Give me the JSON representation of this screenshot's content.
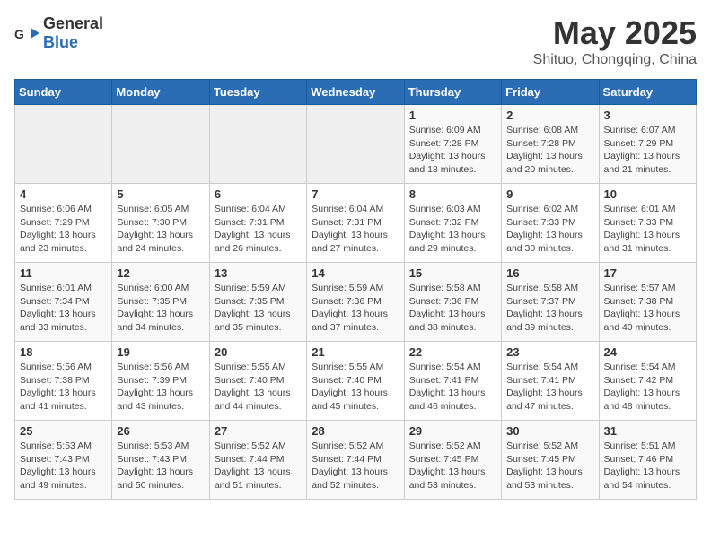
{
  "header": {
    "logo_general": "General",
    "logo_blue": "Blue",
    "title": "May 2025",
    "subtitle": "Shituo, Chongqing, China"
  },
  "weekdays": [
    "Sunday",
    "Monday",
    "Tuesday",
    "Wednesday",
    "Thursday",
    "Friday",
    "Saturday"
  ],
  "weeks": [
    [
      {
        "day": "",
        "info": ""
      },
      {
        "day": "",
        "info": ""
      },
      {
        "day": "",
        "info": ""
      },
      {
        "day": "",
        "info": ""
      },
      {
        "day": "1",
        "info": "Sunrise: 6:09 AM\nSunset: 7:28 PM\nDaylight: 13 hours\nand 18 minutes."
      },
      {
        "day": "2",
        "info": "Sunrise: 6:08 AM\nSunset: 7:28 PM\nDaylight: 13 hours\nand 20 minutes."
      },
      {
        "day": "3",
        "info": "Sunrise: 6:07 AM\nSunset: 7:29 PM\nDaylight: 13 hours\nand 21 minutes."
      }
    ],
    [
      {
        "day": "4",
        "info": "Sunrise: 6:06 AM\nSunset: 7:29 PM\nDaylight: 13 hours\nand 23 minutes."
      },
      {
        "day": "5",
        "info": "Sunrise: 6:05 AM\nSunset: 7:30 PM\nDaylight: 13 hours\nand 24 minutes."
      },
      {
        "day": "6",
        "info": "Sunrise: 6:04 AM\nSunset: 7:31 PM\nDaylight: 13 hours\nand 26 minutes."
      },
      {
        "day": "7",
        "info": "Sunrise: 6:04 AM\nSunset: 7:31 PM\nDaylight: 13 hours\nand 27 minutes."
      },
      {
        "day": "8",
        "info": "Sunrise: 6:03 AM\nSunset: 7:32 PM\nDaylight: 13 hours\nand 29 minutes."
      },
      {
        "day": "9",
        "info": "Sunrise: 6:02 AM\nSunset: 7:33 PM\nDaylight: 13 hours\nand 30 minutes."
      },
      {
        "day": "10",
        "info": "Sunrise: 6:01 AM\nSunset: 7:33 PM\nDaylight: 13 hours\nand 31 minutes."
      }
    ],
    [
      {
        "day": "11",
        "info": "Sunrise: 6:01 AM\nSunset: 7:34 PM\nDaylight: 13 hours\nand 33 minutes."
      },
      {
        "day": "12",
        "info": "Sunrise: 6:00 AM\nSunset: 7:35 PM\nDaylight: 13 hours\nand 34 minutes."
      },
      {
        "day": "13",
        "info": "Sunrise: 5:59 AM\nSunset: 7:35 PM\nDaylight: 13 hours\nand 35 minutes."
      },
      {
        "day": "14",
        "info": "Sunrise: 5:59 AM\nSunset: 7:36 PM\nDaylight: 13 hours\nand 37 minutes."
      },
      {
        "day": "15",
        "info": "Sunrise: 5:58 AM\nSunset: 7:36 PM\nDaylight: 13 hours\nand 38 minutes."
      },
      {
        "day": "16",
        "info": "Sunrise: 5:58 AM\nSunset: 7:37 PM\nDaylight: 13 hours\nand 39 minutes."
      },
      {
        "day": "17",
        "info": "Sunrise: 5:57 AM\nSunset: 7:38 PM\nDaylight: 13 hours\nand 40 minutes."
      }
    ],
    [
      {
        "day": "18",
        "info": "Sunrise: 5:56 AM\nSunset: 7:38 PM\nDaylight: 13 hours\nand 41 minutes."
      },
      {
        "day": "19",
        "info": "Sunrise: 5:56 AM\nSunset: 7:39 PM\nDaylight: 13 hours\nand 43 minutes."
      },
      {
        "day": "20",
        "info": "Sunrise: 5:55 AM\nSunset: 7:40 PM\nDaylight: 13 hours\nand 44 minutes."
      },
      {
        "day": "21",
        "info": "Sunrise: 5:55 AM\nSunset: 7:40 PM\nDaylight: 13 hours\nand 45 minutes."
      },
      {
        "day": "22",
        "info": "Sunrise: 5:54 AM\nSunset: 7:41 PM\nDaylight: 13 hours\nand 46 minutes."
      },
      {
        "day": "23",
        "info": "Sunrise: 5:54 AM\nSunset: 7:41 PM\nDaylight: 13 hours\nand 47 minutes."
      },
      {
        "day": "24",
        "info": "Sunrise: 5:54 AM\nSunset: 7:42 PM\nDaylight: 13 hours\nand 48 minutes."
      }
    ],
    [
      {
        "day": "25",
        "info": "Sunrise: 5:53 AM\nSunset: 7:43 PM\nDaylight: 13 hours\nand 49 minutes."
      },
      {
        "day": "26",
        "info": "Sunrise: 5:53 AM\nSunset: 7:43 PM\nDaylight: 13 hours\nand 50 minutes."
      },
      {
        "day": "27",
        "info": "Sunrise: 5:52 AM\nSunset: 7:44 PM\nDaylight: 13 hours\nand 51 minutes."
      },
      {
        "day": "28",
        "info": "Sunrise: 5:52 AM\nSunset: 7:44 PM\nDaylight: 13 hours\nand 52 minutes."
      },
      {
        "day": "29",
        "info": "Sunrise: 5:52 AM\nSunset: 7:45 PM\nDaylight: 13 hours\nand 53 minutes."
      },
      {
        "day": "30",
        "info": "Sunrise: 5:52 AM\nSunset: 7:45 PM\nDaylight: 13 hours\nand 53 minutes."
      },
      {
        "day": "31",
        "info": "Sunrise: 5:51 AM\nSunset: 7:46 PM\nDaylight: 13 hours\nand 54 minutes."
      }
    ]
  ]
}
